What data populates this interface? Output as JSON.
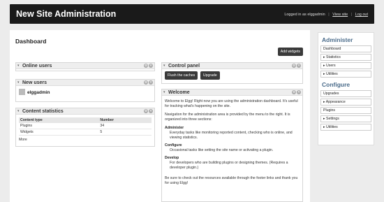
{
  "header": {
    "title": "New Site Administration",
    "logged_in_text": "Logged in as elggadmin",
    "view_site": "View site",
    "log_out": "Log out",
    "separator": "|"
  },
  "main": {
    "title": "Dashboard",
    "add_widgets": "Add widgets"
  },
  "widgets": {
    "online_users": {
      "title": "Online users"
    },
    "new_users": {
      "title": "New users",
      "user": "elggadmin"
    },
    "content_stats": {
      "title": "Content statistics",
      "headers": [
        "Content type",
        "Number"
      ],
      "rows": [
        [
          "Plugins",
          "34"
        ],
        [
          "Widgets",
          "5"
        ]
      ],
      "more": "More"
    },
    "control_panel": {
      "title": "Control panel",
      "flush": "Flush the caches",
      "upgrade": "Upgrade"
    },
    "welcome": {
      "title": "Welcome",
      "p1": "Welcome to Elgg! Right now you are using the administration dashboard. It's useful for tracking what's happening on the site.",
      "p2": "Navigation for the administration area is provided by the menu to the right. It is organized into three sections:",
      "sections": [
        {
          "term": "Administer",
          "desc": "Everyday tasks like monitoring reported content, checking who is online, and viewing statistics."
        },
        {
          "term": "Configure",
          "desc": "Occasional tasks like setting the site name or activating a plugin."
        },
        {
          "term": "Develop",
          "desc": "For developers who are building plugins or designing themes. (Requires a developer plugin.)"
        }
      ],
      "p3": "Be sure to check out the resources available through the footer links and thank you for using Elgg!"
    },
    "ctrl_icons": {
      "settings": "⚙",
      "close": "✕"
    },
    "toggle": "▾"
  },
  "sidebar": {
    "administer_heading": "Administer",
    "administer_items": [
      "Dashboard",
      "▸ Statistics",
      "▸ Users",
      "▸ Utilities"
    ],
    "configure_heading": "Configure",
    "configure_items": [
      "Upgrades",
      "▸ Appearance",
      "Plugins",
      "▸ Settings",
      "▸ Utilities"
    ]
  }
}
